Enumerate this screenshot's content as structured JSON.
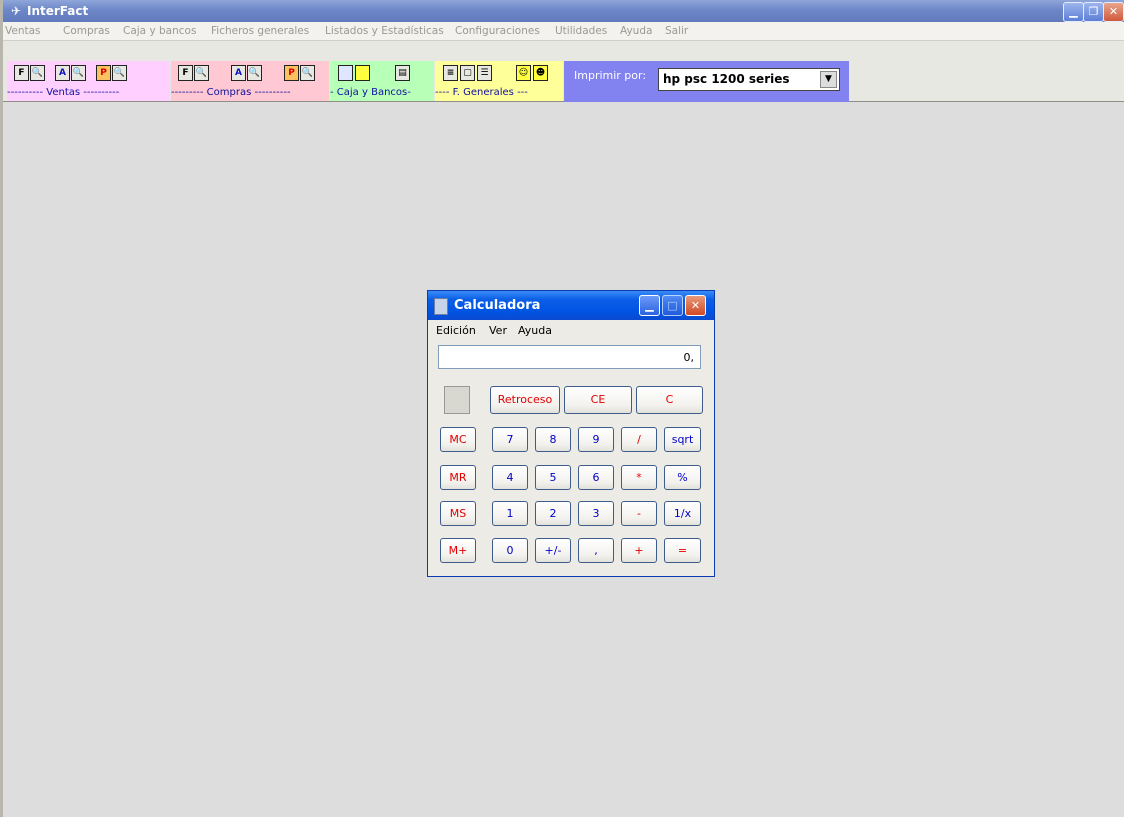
{
  "app": {
    "title": "InterFact",
    "menu": [
      "Ventas",
      "Compras",
      "Caja y bancos",
      "Ficheros generales",
      "Listados y Estadísticas",
      "Configuraciones",
      "Utilidades",
      "Ayuda",
      "Salir"
    ]
  },
  "toolbar": {
    "groups": [
      {
        "label": "---------- Ventas ----------",
        "color": "#ffd0ff"
      },
      {
        "label": "--------- Compras ----------",
        "color": "#ffc8d2"
      },
      {
        "label": "- Caja y Bancos-",
        "color": "#b8ffb8"
      },
      {
        "label": "---- F. Generales ---",
        "color": "#ffff9a"
      }
    ],
    "icon_letters": [
      "F",
      "A",
      "P",
      "F",
      "A",
      "P"
    ],
    "print_label": "Imprimir por:",
    "printer": "hp psc 1200 series"
  },
  "calculator": {
    "title": "Calculadora",
    "menu": [
      "Edición",
      "Ver",
      "Ayuda"
    ],
    "display": "0,",
    "top_keys": [
      "Retroceso",
      "CE",
      "C"
    ],
    "memory_keys": [
      "MC",
      "MR",
      "MS",
      "M+"
    ],
    "rows": [
      [
        "7",
        "8",
        "9",
        "/",
        "sqrt"
      ],
      [
        "4",
        "5",
        "6",
        "*",
        "%"
      ],
      [
        "1",
        "2",
        "3",
        "-",
        "1/x"
      ],
      [
        "0",
        "+/-",
        ",",
        "+",
        "="
      ]
    ]
  }
}
